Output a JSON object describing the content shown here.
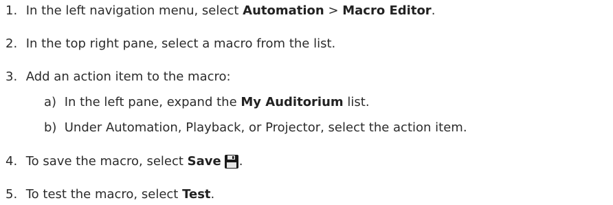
{
  "steps": [
    {
      "number": "1.",
      "parts": [
        "In the left navigation menu, select ",
        "Automation",
        " > ",
        "Macro Editor",
        "."
      ]
    },
    {
      "number": "2.",
      "text": "In the top right pane, select a macro from the list."
    },
    {
      "number": "3.",
      "text": "Add an action item to the macro:",
      "substeps": [
        {
          "letter": "a)",
          "parts": [
            "In the left pane, expand the ",
            "My Auditorium",
            " list."
          ]
        },
        {
          "letter": "b)",
          "text": "Under Automation, Playback, or Projector, select the action item."
        }
      ]
    },
    {
      "number": "4.",
      "parts": [
        "To save the macro, select ",
        "Save",
        "."
      ],
      "icon": "floppy-disk-save-icon"
    },
    {
      "number": "5.",
      "parts": [
        "To test the macro, select ",
        "Test",
        "."
      ]
    }
  ]
}
